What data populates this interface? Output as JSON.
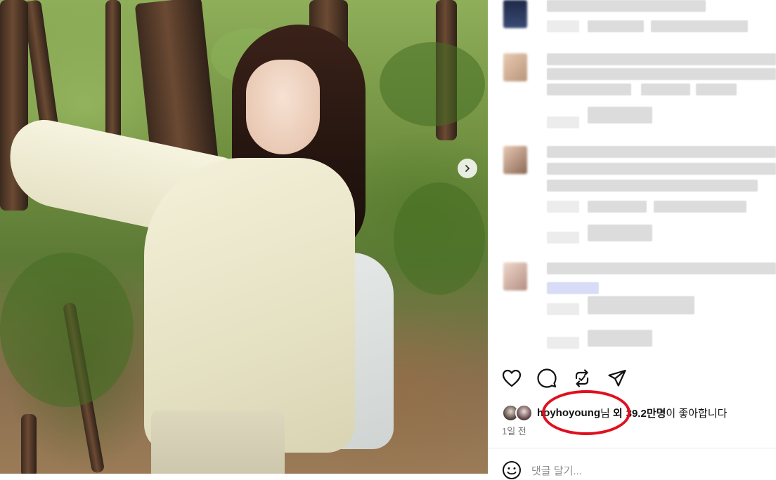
{
  "post": {
    "image": {
      "alt_subject": "Woman in a sheer cream jacket with a light grey sling bag, posing against a tree in a forest"
    },
    "carousel": {
      "next_icon": "chevron-right-icon"
    },
    "actions": [
      {
        "name": "like-button",
        "icon": "heart-icon"
      },
      {
        "name": "comment-button",
        "icon": "speech-bubble-icon"
      },
      {
        "name": "repost-button",
        "icon": "repost-icon"
      },
      {
        "name": "share-button",
        "icon": "send-icon"
      }
    ],
    "likes": {
      "username": "hoyhoyoung",
      "name_suffix": "님",
      "oe": "외",
      "count": "39.2만명",
      "tail": "이 좋아합니다"
    },
    "timestamp": "1일 전",
    "comment_input": {
      "icon": "emoji-icon",
      "placeholder": "댓글 달기..."
    }
  },
  "highlight": {
    "color": "#e0101e"
  },
  "colors": {
    "text": "#111111",
    "muted": "#737373",
    "divider": "#e6e6e6"
  }
}
